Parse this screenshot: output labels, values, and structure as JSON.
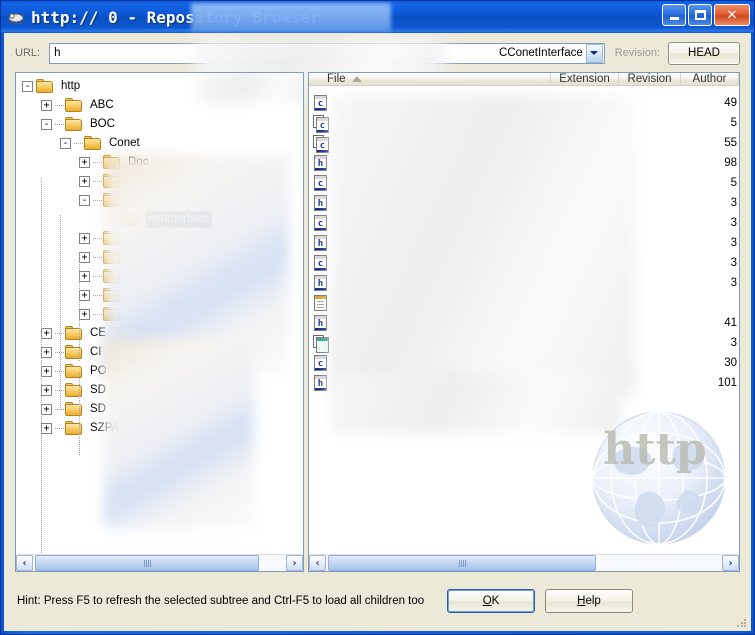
{
  "window": {
    "title": "http://                         0 - Repository Browser",
    "title_prefix": "http:/",
    "title_suffix": "0 - Repository Browser",
    "icon": "repo-browser-icon",
    "minimize_label": "Minimize",
    "maximize_label": "Maximize",
    "close_label": "Close"
  },
  "toolbar": {
    "url_label": "URL:",
    "url_value": "CConetInterface",
    "url_prefix": "h",
    "dropdown_icon": "chevron-down-icon",
    "revision_label": "Revision:",
    "head_button": "HEAD"
  },
  "tree": {
    "nodes": [
      {
        "label": "http",
        "depth": 0,
        "state": "-",
        "selected": false
      },
      {
        "label": "ABC",
        "depth": 1,
        "state": "+",
        "selected": false
      },
      {
        "label": "BOC",
        "depth": 1,
        "state": "-",
        "selected": false
      },
      {
        "label": "Conet",
        "depth": 2,
        "state": "-",
        "selected": false
      },
      {
        "label": "Doc",
        "depth": 3,
        "state": "+",
        "selected": false
      },
      {
        "label": "",
        "depth": 3,
        "state": "+",
        "selected": false
      },
      {
        "label": "",
        "depth": 3,
        "state": "-",
        "selected": false
      },
      {
        "label": "netInterface",
        "depth": 4,
        "state": "",
        "selected": true
      },
      {
        "label": "",
        "depth": 3,
        "state": "+",
        "selected": false
      },
      {
        "label": "",
        "depth": 3,
        "state": "+",
        "selected": false
      },
      {
        "label": "",
        "depth": 3,
        "state": "+",
        "selected": false
      },
      {
        "label": "",
        "depth": 3,
        "state": "+",
        "selected": false
      },
      {
        "label": "",
        "depth": 3,
        "state": "+",
        "selected": false
      },
      {
        "label": "CE",
        "depth": 1,
        "state": "+",
        "selected": false
      },
      {
        "label": "CI",
        "depth": 1,
        "state": "+",
        "selected": false
      },
      {
        "label": "PO",
        "depth": 1,
        "state": "+",
        "selected": false
      },
      {
        "label": "SD",
        "depth": 1,
        "state": "+",
        "selected": false
      },
      {
        "label": "SD",
        "depth": 1,
        "state": "+",
        "selected": false
      },
      {
        "label": "SZPA",
        "depth": 1,
        "state": "+",
        "selected": false
      }
    ],
    "scrollbar": {
      "left_arrow": "‹",
      "right_arrow": "›"
    }
  },
  "filelist": {
    "columns": [
      {
        "key": "file",
        "label": "File",
        "sorted": "asc"
      },
      {
        "key": "ext",
        "label": "Extension"
      },
      {
        "key": "rev",
        "label": "Revision"
      },
      {
        "key": "auth",
        "label": "Author"
      }
    ],
    "sort_icon": "sort-ascending-icon",
    "rows": [
      {
        "icon": "cpp-file-icon",
        "rev": "49"
      },
      {
        "icon": "copy-file-icon",
        "rev": "5"
      },
      {
        "icon": "copy-file-icon",
        "rev": "55"
      },
      {
        "icon": "h-file-icon",
        "rev": "98"
      },
      {
        "icon": "cpp-file-icon",
        "rev": "5"
      },
      {
        "icon": "h-file-icon",
        "rev": "3"
      },
      {
        "icon": "cpp-file-icon",
        "rev": "3"
      },
      {
        "icon": "h-file-icon",
        "rev": "3"
      },
      {
        "icon": "cpp-file-icon",
        "rev": "3"
      },
      {
        "icon": "h-file-icon",
        "rev": "3"
      },
      {
        "icon": "note-file-icon",
        "rev": ""
      },
      {
        "icon": "h-file-icon",
        "rev": "41"
      },
      {
        "icon": "image-file-icon",
        "rev": "3"
      },
      {
        "icon": "cpp-file-icon",
        "rev": "30"
      },
      {
        "icon": "h-file-icon",
        "rev": "101"
      }
    ],
    "scrollbar": {
      "left_arrow": "‹",
      "right_arrow": "›"
    }
  },
  "watermark": {
    "text": "http",
    "icon": "globe-icon"
  },
  "footer": {
    "hint": "Hint: Press F5 to refresh the selected subtree and Ctrl-F5 to load all children too",
    "ok_pre": "",
    "ok_key": "O",
    "ok_post": "K",
    "help_pre": "",
    "help_key": "H",
    "help_post": "elp"
  }
}
